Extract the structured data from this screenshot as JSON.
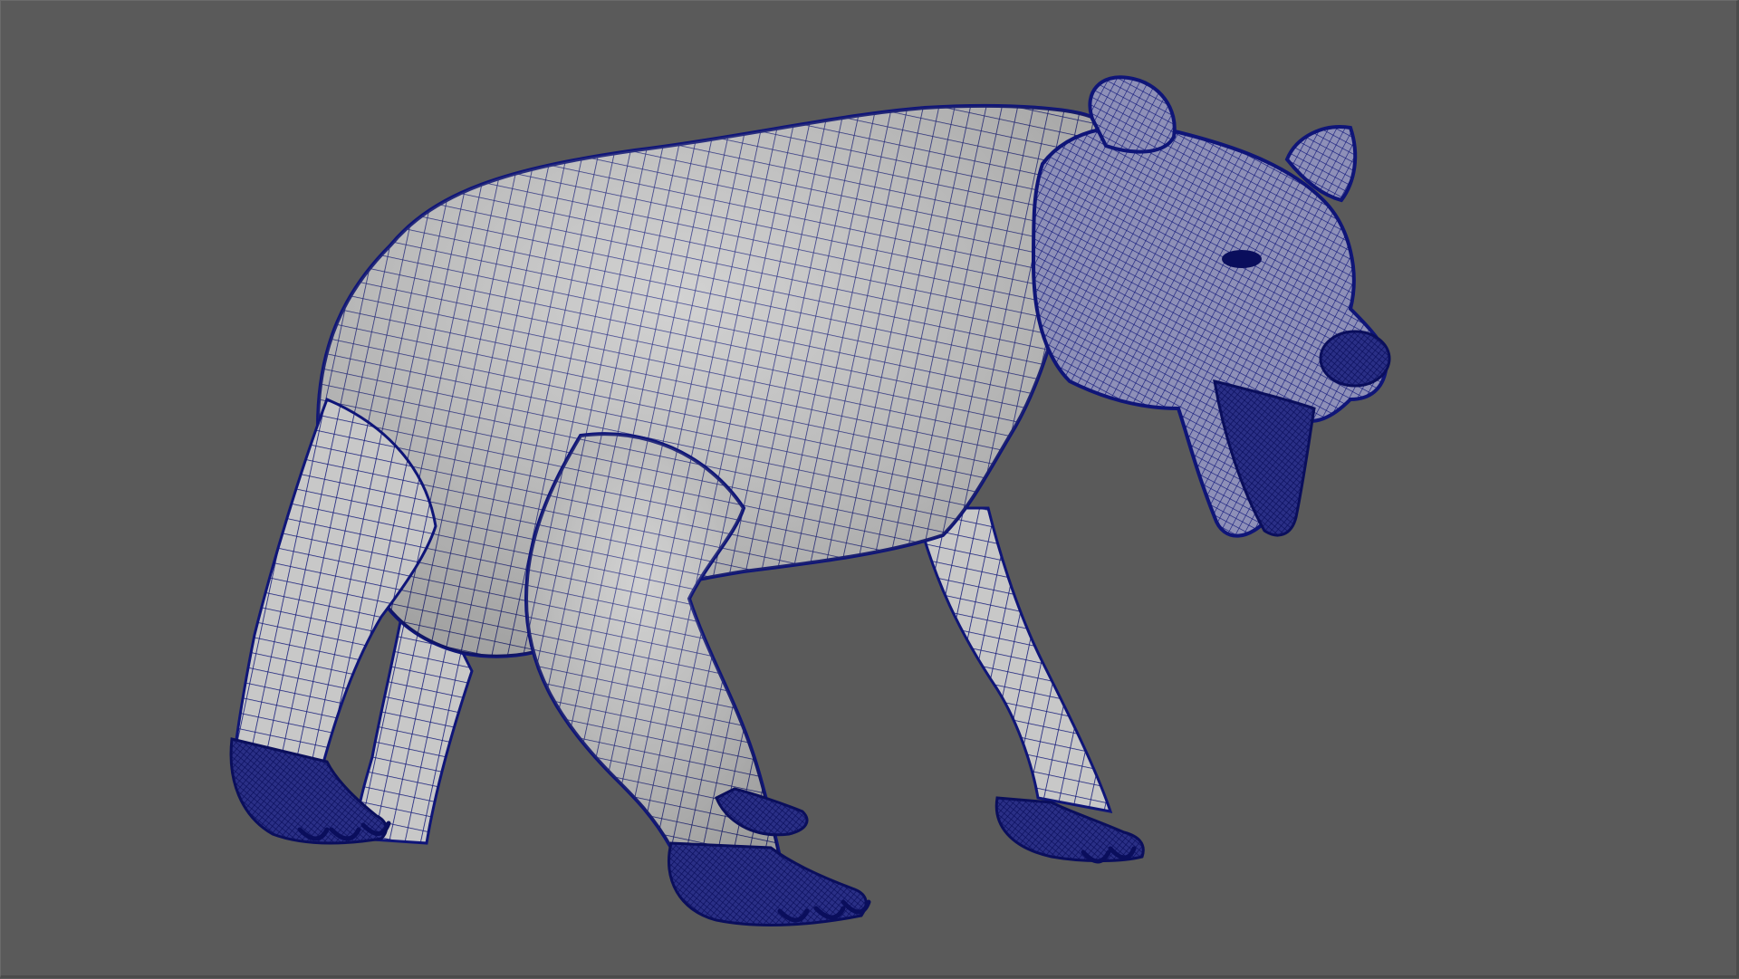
{
  "viewport": {
    "background_color": "#5a5a5a",
    "display_mode": "wireframe-on-shaded"
  },
  "model": {
    "subject": "bear",
    "surface_color": "#c9c9c9",
    "wireframe_color": "#0f1578",
    "dense_detail_color": "#0a0e5c"
  }
}
